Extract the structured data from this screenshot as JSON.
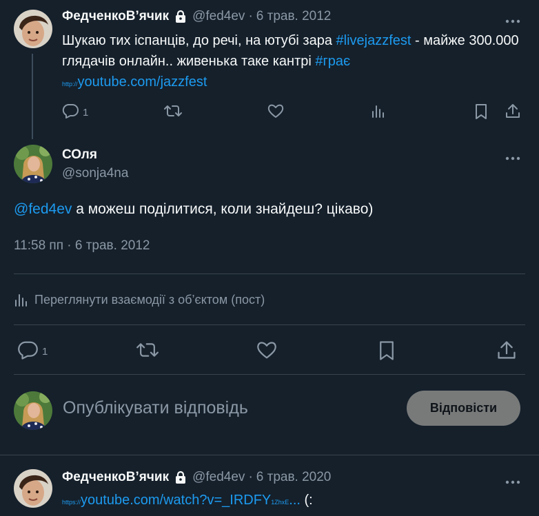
{
  "tweet1": {
    "author_name": "ФедченкоВ’ячик",
    "handle": "@fed4ev",
    "date": "6 трав. 2012",
    "text_part1": "Шукаю тих іспанців, до речі, на ютубі зара ",
    "hashtag1": "#livejazzfest",
    "text_part2": " - майже 300.000 глядачів онлайн.. живенька таке кантрі ",
    "hashtag2": "#грає",
    "link_prefix": "http://",
    "link_text": "youtube.com/jazzfest",
    "reply_count": "1"
  },
  "tweet2": {
    "author_name": "СОля",
    "handle": "@sonja4na",
    "mention": "@fed4ev",
    "text": " а можеш поділитися, коли знайдеш? цікаво)",
    "timestamp": "11:58 пп · 6 трав. 2012",
    "view_interactions": "Переглянути взаємодії з об’єктом (пост)",
    "reply_count": "1"
  },
  "composer": {
    "placeholder": "Опублікувати відповідь",
    "reply_button": "Відповісти"
  },
  "tweet3": {
    "author_name": "ФедченкоВ’ячик",
    "handle": "@fed4ev",
    "date": "6 трав. 2020",
    "link_prefix": "https://",
    "link_text": "youtube.com/watch?v=_IRDFY",
    "link_suffix": "1ZhxE",
    "link_ellipsis": "...",
    "text_after": " (:"
  },
  "icons": [
    "lock-icon",
    "more-icon",
    "reply-icon",
    "retweet-icon",
    "like-icon",
    "views-icon",
    "bookmark-icon",
    "share-icon"
  ],
  "colors": {
    "background": "#15202b",
    "accent": "#1d9bf0",
    "muted": "#8b98a5",
    "divider": "#38444d"
  }
}
